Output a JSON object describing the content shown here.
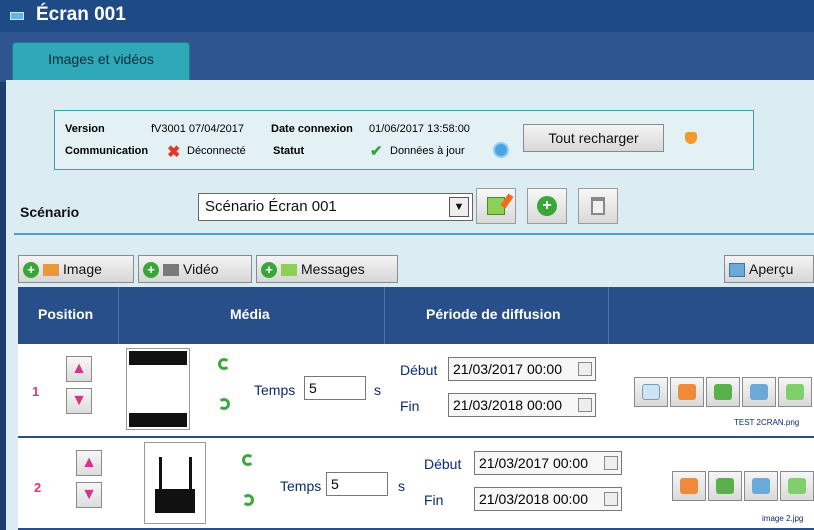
{
  "window": {
    "title": "Écran 001"
  },
  "tabs": [
    {
      "label": "Images et vidéos"
    }
  ],
  "info": {
    "version_label": "Version",
    "version_value": "fV3001 07/04/2017",
    "date_label": "Date connexion",
    "date_value": "01/06/2017 13:58:00",
    "communication_label": "Communication",
    "communication_value": "Déconnecté",
    "statut_label": "Statut",
    "statut_value": "Données à jour",
    "reload_button": "Tout recharger"
  },
  "scenario": {
    "label": "Scénario",
    "selected": "Scénario Écran 001"
  },
  "toolbar": {
    "image": "Image",
    "video": "Vidéo",
    "messages": "Messages",
    "preview": "Aperçu"
  },
  "table": {
    "headers": {
      "position": "Position",
      "media": "Média",
      "period": "Période de diffusion"
    },
    "rows": [
      {
        "position": "1",
        "temps_label": "Temps",
        "temps_value": "5",
        "unit": "s",
        "debut_label": "Début",
        "debut_value": "21/03/2017 00:00",
        "fin_label": "Fin",
        "fin_value": "21/03/2018 00:00",
        "filename": "TEST 2CRAN.png"
      },
      {
        "position": "2",
        "temps_label": "Temps",
        "temps_value": "5",
        "unit": "s",
        "debut_label": "Début",
        "debut_value": "21/03/2017 00:00",
        "fin_label": "Fin",
        "fin_value": "21/03/2018 00:00",
        "filename": "image 2.jpg"
      }
    ]
  },
  "colors": {
    "titlebar": "#1e4a86",
    "tab": "#2fa8b8",
    "table_header": "#294f8a",
    "position_number": "#d63a7a"
  }
}
